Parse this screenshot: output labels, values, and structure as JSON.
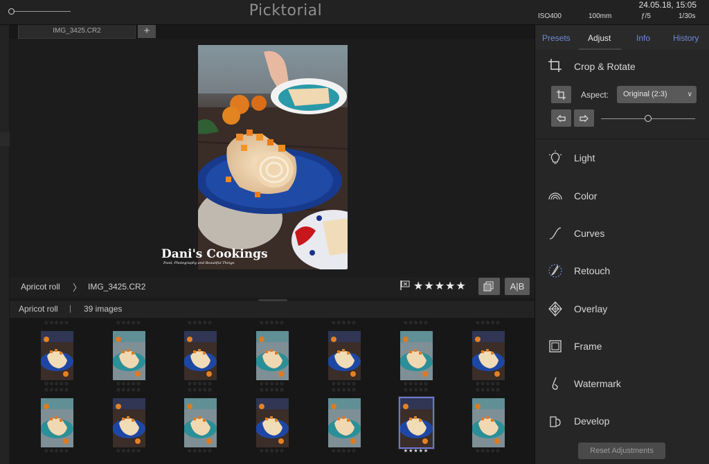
{
  "app": {
    "title": "Picktorial"
  },
  "topbar": {
    "datetime": "24.05.18, 15:05",
    "exif": {
      "iso": "ISO400",
      "focal": "100mm",
      "aperture": "ƒ/5",
      "shutter": "1/30s"
    }
  },
  "file_tab": {
    "label": "IMG_3425.CR2",
    "add_label": "+"
  },
  "info_row": {
    "album": "Apricot roll",
    "separator": "〉",
    "file": "IMG_3425.CR2",
    "rating_stars": "★★★★★",
    "ab_label": "A|B"
  },
  "photo": {
    "watermark_title": "Dani's Cookings",
    "watermark_subtitle": "Food, Photography and Beautiful Things"
  },
  "strip": {
    "album": "Apricot roll",
    "separator": "|",
    "count": "39 images",
    "empty_stars": "☆☆☆☆☆",
    "full_stars": "★★★★★"
  },
  "panel": {
    "tabs": [
      "Presets",
      "Adjust",
      "Info",
      "History"
    ],
    "active_tab": "Adjust",
    "crop": {
      "title": "Crop & Rotate",
      "aspect_label": "Aspect:",
      "aspect_value": "Original (2:3)"
    },
    "tools": [
      "Light",
      "Color",
      "Curves",
      "Retouch",
      "Overlay",
      "Frame",
      "Watermark",
      "Develop"
    ],
    "reset_label": "Reset Adjustments"
  },
  "icons": {
    "crop": "crop-rotate-icon",
    "light": "bulb-icon",
    "color": "rainbow-icon",
    "curves": "curve-icon",
    "retouch": "brush-icon",
    "overlay": "overlay-icon",
    "frame": "frame-icon",
    "watermark": "watermark-icon",
    "develop": "develop-icon"
  },
  "colors": {
    "accent": "#6e8bd6",
    "selected_border": "#6e78d8"
  }
}
